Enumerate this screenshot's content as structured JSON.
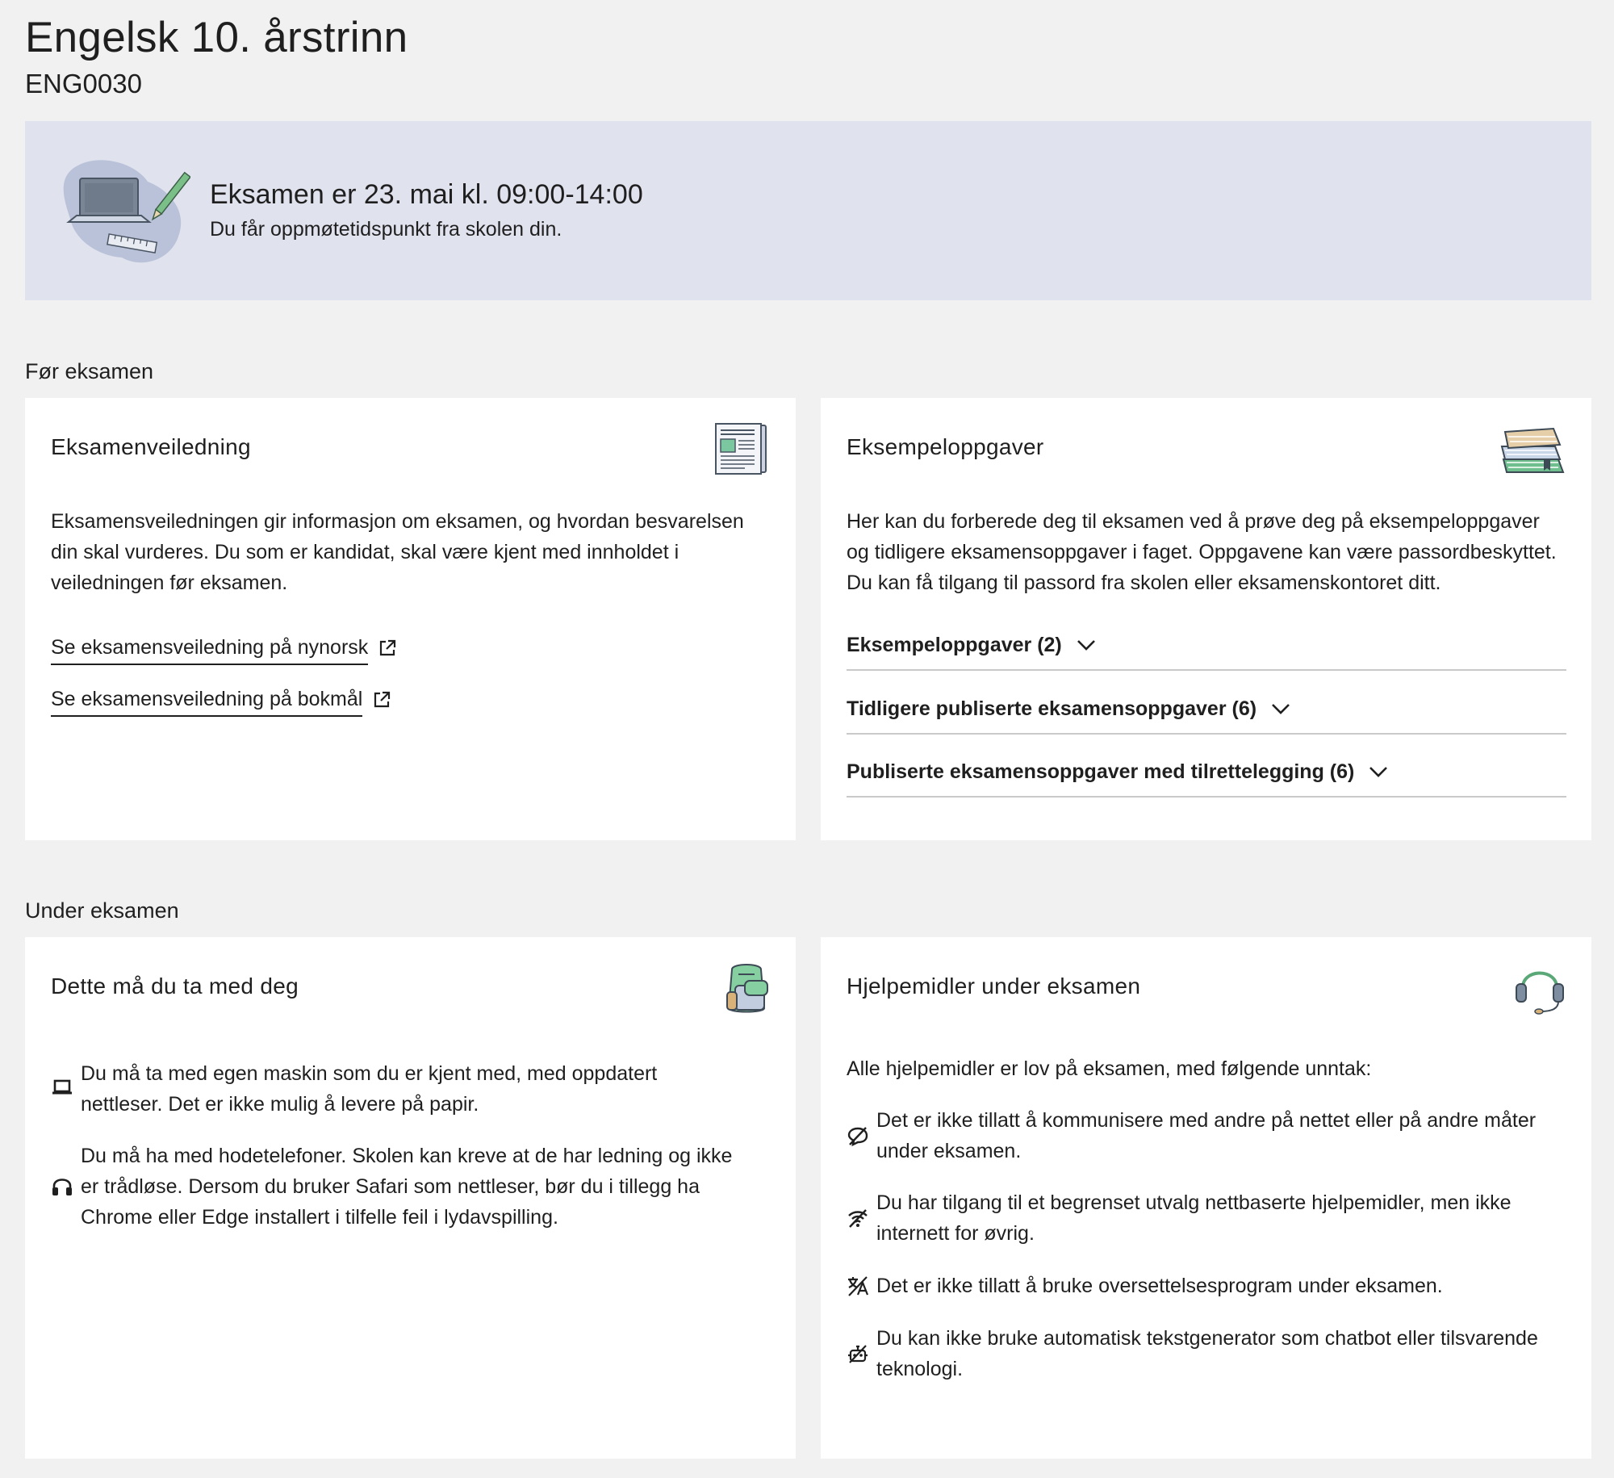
{
  "header": {
    "title": "Engelsk 10. årstrinn",
    "code": "ENG0030"
  },
  "banner": {
    "illustration": "laptop-pencil-ruler-illustration",
    "title": "Eksamen er 23. mai kl. 09:00-14:00",
    "subtitle": "Du får oppmøtetidspunkt fra skolen din."
  },
  "before": {
    "heading": "Før eksamen",
    "guide": {
      "title": "Eksamenveiledning",
      "icon": "newspaper-icon",
      "text_lines": [
        "Eksamensveiledningen gir informasjon om eksamen, og hvordan besvarelsen",
        "din skal vurderes. Du som er kandidat, skal være kjent med innholdet i",
        "veiledningen før eksamen."
      ],
      "links": [
        {
          "label": "Se eksamensveiledning på nynorsk",
          "icon": "external-link-icon"
        },
        {
          "label": "Se eksamensveiledning på bokmål",
          "icon": "external-link-icon"
        }
      ]
    },
    "examples": {
      "title": "Eksempeloppgaver",
      "icon": "books-icon",
      "text_lines": [
        "Her kan du forberede deg til eksamen ved å prøve deg på eksempeloppgaver",
        "og tidligere eksamensoppgaver i faget. Oppgavene kan være passordbeskyttet.",
        "Du kan få tilgang til passord fra skolen eller eksamenskontoret ditt."
      ],
      "accordions": [
        {
          "label": "Eksempeloppgaver (2)",
          "icon": "chevron-down-icon"
        },
        {
          "label": "Tidligere publiserte eksamensoppgaver (6)",
          "icon": "chevron-down-icon"
        },
        {
          "label": "Publiserte eksamensoppgaver med tilrettelegging (6)",
          "icon": "chevron-down-icon"
        }
      ]
    }
  },
  "during": {
    "heading": "Under eksamen",
    "bring": {
      "title": "Dette må du ta med deg",
      "icon": "backpack-icon",
      "items": [
        {
          "icon": "laptop-icon",
          "lines": [
            "Du må ta med egen maskin som du er kjent med, med oppdatert",
            "nettleser. Det er ikke mulig å levere på papir."
          ]
        },
        {
          "icon": "headphones-icon",
          "lines": [
            "Du må ha med hodetelefoner. Skolen kan kreve at de har ledning og ikke",
            "er trådløse. Dersom du bruker Safari som nettleser, bør du i tillegg ha",
            "Chrome eller Edge installert i tilfelle feil i lydavspilling."
          ]
        }
      ]
    },
    "aids": {
      "title": "Hjelpemidler under eksamen",
      "icon": "headset-icon",
      "intro": "Alle hjelpemidler er lov på eksamen, med følgende unntak:",
      "items": [
        {
          "icon": "no-chat-icon",
          "lines": [
            "Det er ikke tillatt å kommunisere med andre på nettet eller på andre måter",
            "under eksamen."
          ]
        },
        {
          "icon": "wifi-off-icon",
          "lines": [
            "Du har tilgang til et begrenset utvalg nettbaserte hjelpemidler, men ikke",
            "internett for øvrig."
          ]
        },
        {
          "icon": "translate-off-icon",
          "lines": [
            "Det er ikke tillatt å bruke oversettelsesprogram under eksamen."
          ]
        },
        {
          "icon": "no-bot-icon",
          "lines": [
            "Du kan ikke bruke automatisk tekstgenerator som chatbot eller tilsvarende",
            "teknologi."
          ]
        }
      ]
    }
  }
}
